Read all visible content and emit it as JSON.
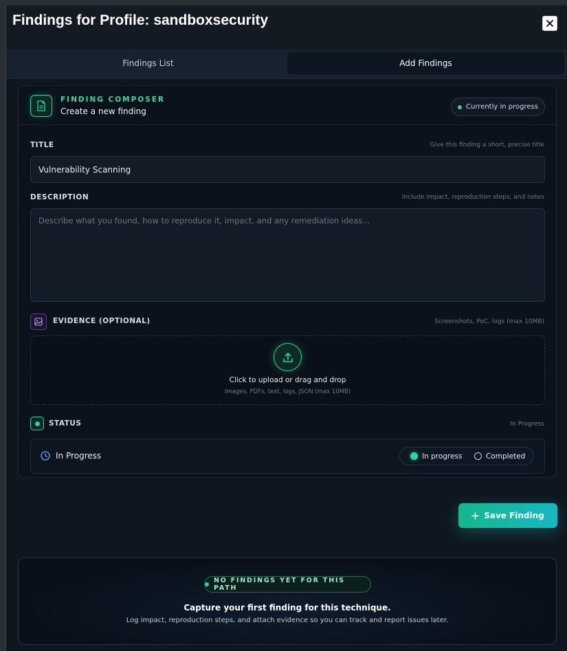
{
  "modal": {
    "title": "Findings for Profile: sandboxsecurity",
    "close_icon": "close-icon"
  },
  "tabs": [
    {
      "label": "Findings List",
      "active": false
    },
    {
      "label": "Add Findings",
      "active": true
    }
  ],
  "composer": {
    "kicker": "FINDING COMPOSER",
    "subtitle": "Create a new finding",
    "status_pill": "Currently in progress",
    "title_field": {
      "label": "TITLE",
      "hint": "Give this finding a short, precise title",
      "value": "Vulnerability Scanning"
    },
    "description_field": {
      "label": "DESCRIPTION",
      "hint": "Include impact, reproduction steps, and notes",
      "placeholder": "Describe what you found, how to reproduce it, impact, and any remediation ideas..."
    },
    "evidence": {
      "label": "EVIDENCE (OPTIONAL)",
      "hint": "Screenshots, PoC, logs (max 10MB)",
      "upload_main": "Click to upload or drag and drop",
      "upload_sub": "Images, PDFs, text, logs, JSON (max 10MB)"
    },
    "status": {
      "label": "STATUS",
      "hint": "In Progress",
      "current": "In Progress",
      "options": [
        {
          "label": "In progress",
          "selected": true
        },
        {
          "label": "Completed",
          "selected": false
        }
      ]
    }
  },
  "save_button": {
    "label": "Save Finding"
  },
  "empty_state": {
    "pill": "NO FINDINGS YET FOR THIS PATH",
    "title": "Capture your first finding for this technique.",
    "subtitle": "Log impact, reproduction steps, and attach evidence so you can track and report issues later."
  },
  "colors": {
    "accent": "#2bd4a0",
    "background": "#0f1620",
    "panel": "#0b121c"
  }
}
